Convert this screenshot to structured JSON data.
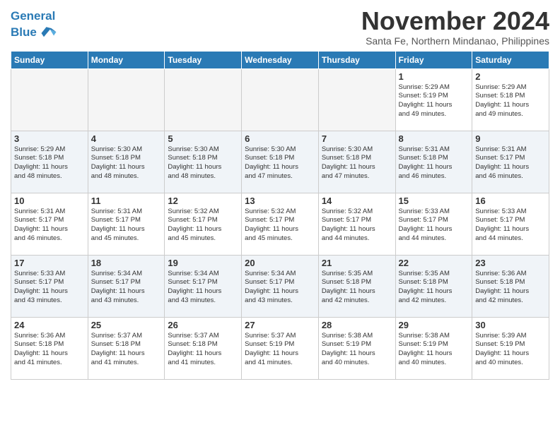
{
  "header": {
    "logo_line1": "General",
    "logo_line2": "Blue",
    "month": "November 2024",
    "location": "Santa Fe, Northern Mindanao, Philippines"
  },
  "weekdays": [
    "Sunday",
    "Monday",
    "Tuesday",
    "Wednesday",
    "Thursday",
    "Friday",
    "Saturday"
  ],
  "weeks": [
    [
      {
        "day": "",
        "info": ""
      },
      {
        "day": "",
        "info": ""
      },
      {
        "day": "",
        "info": ""
      },
      {
        "day": "",
        "info": ""
      },
      {
        "day": "",
        "info": ""
      },
      {
        "day": "1",
        "info": "Sunrise: 5:29 AM\nSunset: 5:19 PM\nDaylight: 11 hours\nand 49 minutes."
      },
      {
        "day": "2",
        "info": "Sunrise: 5:29 AM\nSunset: 5:18 PM\nDaylight: 11 hours\nand 49 minutes."
      }
    ],
    [
      {
        "day": "3",
        "info": "Sunrise: 5:29 AM\nSunset: 5:18 PM\nDaylight: 11 hours\nand 48 minutes."
      },
      {
        "day": "4",
        "info": "Sunrise: 5:30 AM\nSunset: 5:18 PM\nDaylight: 11 hours\nand 48 minutes."
      },
      {
        "day": "5",
        "info": "Sunrise: 5:30 AM\nSunset: 5:18 PM\nDaylight: 11 hours\nand 48 minutes."
      },
      {
        "day": "6",
        "info": "Sunrise: 5:30 AM\nSunset: 5:18 PM\nDaylight: 11 hours\nand 47 minutes."
      },
      {
        "day": "7",
        "info": "Sunrise: 5:30 AM\nSunset: 5:18 PM\nDaylight: 11 hours\nand 47 minutes."
      },
      {
        "day": "8",
        "info": "Sunrise: 5:31 AM\nSunset: 5:18 PM\nDaylight: 11 hours\nand 46 minutes."
      },
      {
        "day": "9",
        "info": "Sunrise: 5:31 AM\nSunset: 5:17 PM\nDaylight: 11 hours\nand 46 minutes."
      }
    ],
    [
      {
        "day": "10",
        "info": "Sunrise: 5:31 AM\nSunset: 5:17 PM\nDaylight: 11 hours\nand 46 minutes."
      },
      {
        "day": "11",
        "info": "Sunrise: 5:31 AM\nSunset: 5:17 PM\nDaylight: 11 hours\nand 45 minutes."
      },
      {
        "day": "12",
        "info": "Sunrise: 5:32 AM\nSunset: 5:17 PM\nDaylight: 11 hours\nand 45 minutes."
      },
      {
        "day": "13",
        "info": "Sunrise: 5:32 AM\nSunset: 5:17 PM\nDaylight: 11 hours\nand 45 minutes."
      },
      {
        "day": "14",
        "info": "Sunrise: 5:32 AM\nSunset: 5:17 PM\nDaylight: 11 hours\nand 44 minutes."
      },
      {
        "day": "15",
        "info": "Sunrise: 5:33 AM\nSunset: 5:17 PM\nDaylight: 11 hours\nand 44 minutes."
      },
      {
        "day": "16",
        "info": "Sunrise: 5:33 AM\nSunset: 5:17 PM\nDaylight: 11 hours\nand 44 minutes."
      }
    ],
    [
      {
        "day": "17",
        "info": "Sunrise: 5:33 AM\nSunset: 5:17 PM\nDaylight: 11 hours\nand 43 minutes."
      },
      {
        "day": "18",
        "info": "Sunrise: 5:34 AM\nSunset: 5:17 PM\nDaylight: 11 hours\nand 43 minutes."
      },
      {
        "day": "19",
        "info": "Sunrise: 5:34 AM\nSunset: 5:17 PM\nDaylight: 11 hours\nand 43 minutes."
      },
      {
        "day": "20",
        "info": "Sunrise: 5:34 AM\nSunset: 5:17 PM\nDaylight: 11 hours\nand 43 minutes."
      },
      {
        "day": "21",
        "info": "Sunrise: 5:35 AM\nSunset: 5:18 PM\nDaylight: 11 hours\nand 42 minutes."
      },
      {
        "day": "22",
        "info": "Sunrise: 5:35 AM\nSunset: 5:18 PM\nDaylight: 11 hours\nand 42 minutes."
      },
      {
        "day": "23",
        "info": "Sunrise: 5:36 AM\nSunset: 5:18 PM\nDaylight: 11 hours\nand 42 minutes."
      }
    ],
    [
      {
        "day": "24",
        "info": "Sunrise: 5:36 AM\nSunset: 5:18 PM\nDaylight: 11 hours\nand 41 minutes."
      },
      {
        "day": "25",
        "info": "Sunrise: 5:37 AM\nSunset: 5:18 PM\nDaylight: 11 hours\nand 41 minutes."
      },
      {
        "day": "26",
        "info": "Sunrise: 5:37 AM\nSunset: 5:18 PM\nDaylight: 11 hours\nand 41 minutes."
      },
      {
        "day": "27",
        "info": "Sunrise: 5:37 AM\nSunset: 5:19 PM\nDaylight: 11 hours\nand 41 minutes."
      },
      {
        "day": "28",
        "info": "Sunrise: 5:38 AM\nSunset: 5:19 PM\nDaylight: 11 hours\nand 40 minutes."
      },
      {
        "day": "29",
        "info": "Sunrise: 5:38 AM\nSunset: 5:19 PM\nDaylight: 11 hours\nand 40 minutes."
      },
      {
        "day": "30",
        "info": "Sunrise: 5:39 AM\nSunset: 5:19 PM\nDaylight: 11 hours\nand 40 minutes."
      }
    ]
  ]
}
